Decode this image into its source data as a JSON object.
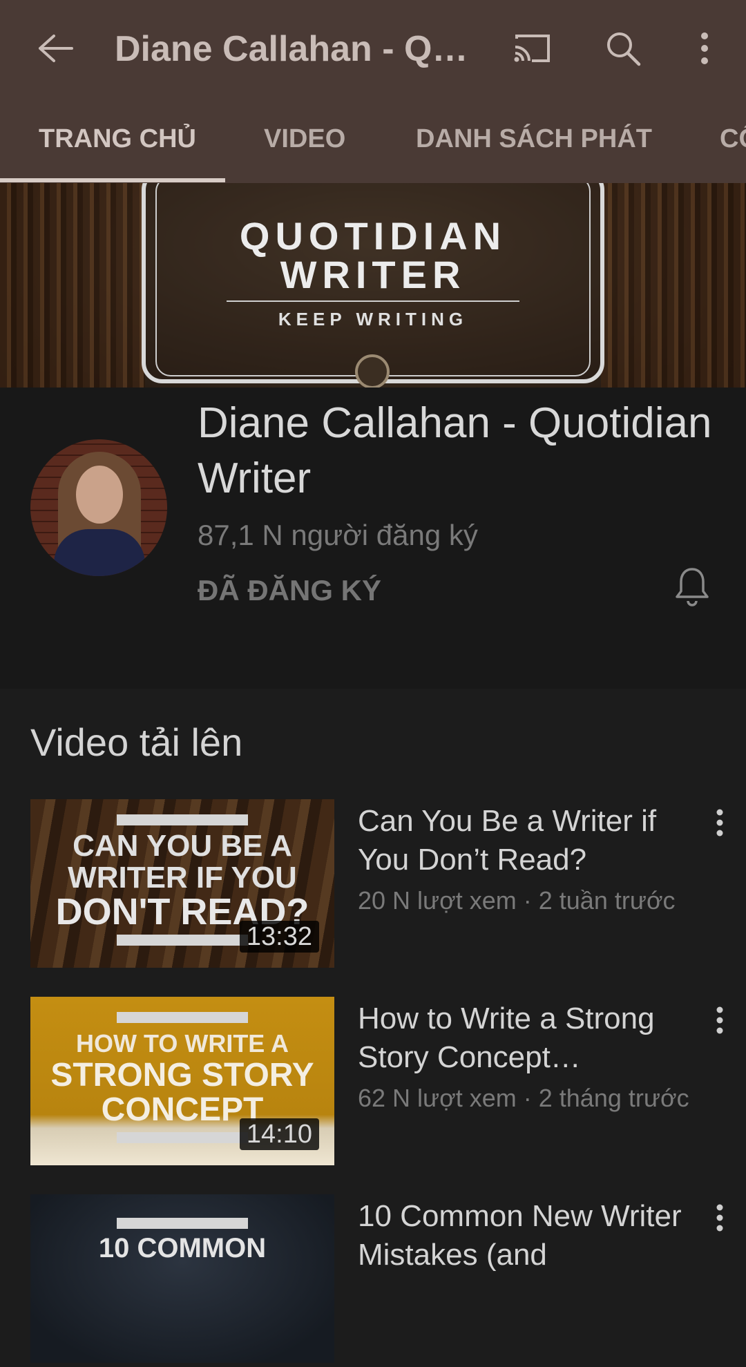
{
  "topbar": {
    "title": "Diane Callahan - Quotidian Writer",
    "icons": [
      "back-arrow-icon",
      "cast-icon",
      "search-icon",
      "more-vert-icon"
    ]
  },
  "tabs": [
    {
      "label": "TRANG CHỦ",
      "active": true
    },
    {
      "label": "VIDEO",
      "active": false
    },
    {
      "label": "DANH SÁCH PHÁT",
      "active": false
    },
    {
      "label": "CỘNG ĐỒNG",
      "active": false
    }
  ],
  "banner": {
    "line1": "QUOTIDIAN",
    "line2": "WRITER",
    "tagline": "KEEP WRITING"
  },
  "channel": {
    "name": "Diane Callahan - Quotidian Writer",
    "subscribers": "87,1 N người đăng ký",
    "subscribe_state": "ĐÃ ĐĂNG KÝ"
  },
  "uploads": {
    "heading": "Video tải lên",
    "videos": [
      {
        "title": "Can You Be a Writer if You Don’t Read?",
        "meta": "20 N lượt xem · 2 tuần trước",
        "duration": "13:32",
        "thumb_lines": [
          "CAN YOU BE A",
          "WRITER IF YOU",
          "DON'T READ?"
        ]
      },
      {
        "title": "How to Write a Strong Story Concept…",
        "meta": "62 N lượt xem · 2 tháng trước",
        "duration": "14:10",
        "thumb_lines": [
          "HOW TO WRITE A",
          "STRONG STORY",
          "CONCEPT"
        ]
      },
      {
        "title": "10 Common New Writer Mistakes (and",
        "meta": "",
        "duration": "",
        "thumb_lines": [
          "10 COMMON"
        ]
      }
    ]
  },
  "colors": {
    "appbar": "#4a3a35",
    "background": "#1c1c1c",
    "channel_header": "#181818",
    "text_primary": "#d4d4d4",
    "text_secondary": "#7a7a7a"
  }
}
